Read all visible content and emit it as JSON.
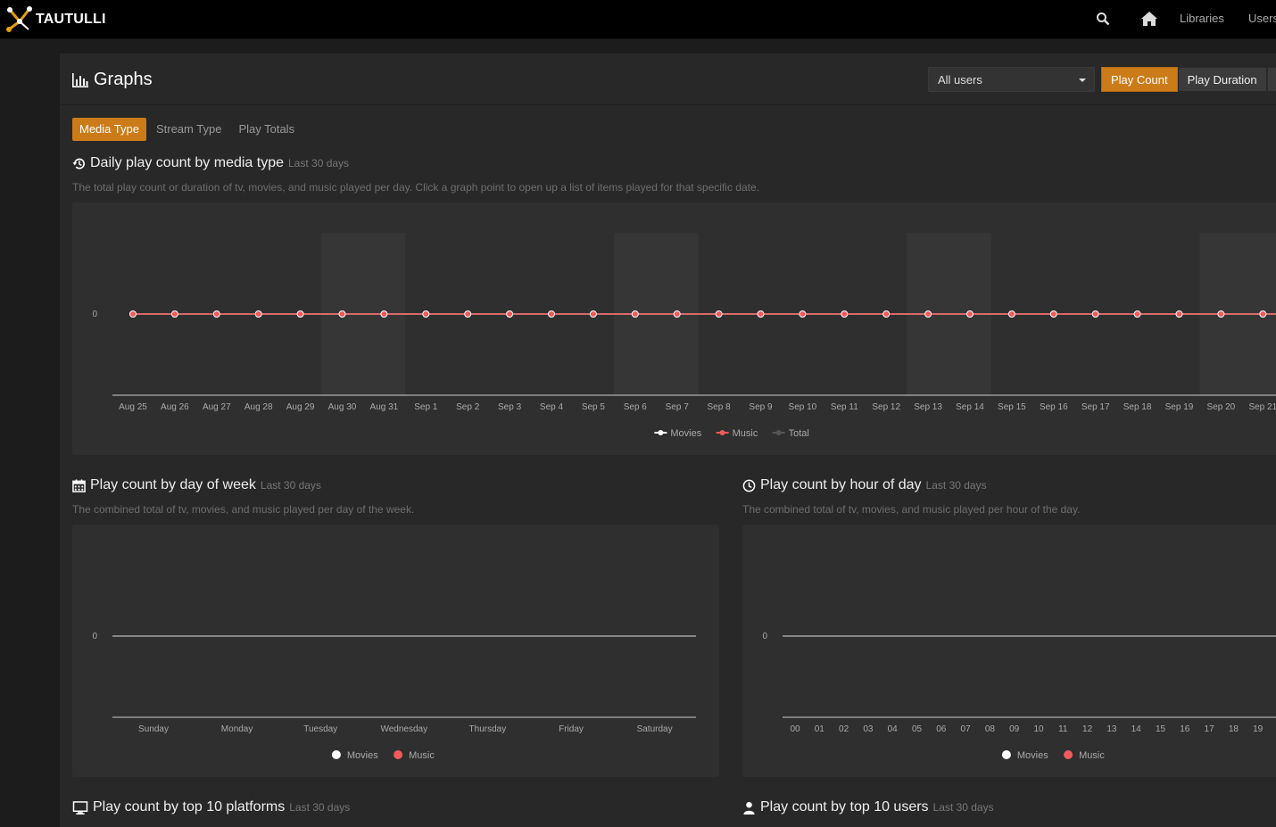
{
  "app": {
    "brand": "TAUTULLI"
  },
  "nav": {
    "links": [
      "Libraries",
      "Users"
    ]
  },
  "page": {
    "title": "Graphs",
    "user_filter": "All users",
    "metric_buttons": [
      "Play Count",
      "Play Duration"
    ],
    "active_metric": "Play Count",
    "tabs": [
      "Media Type",
      "Stream Type",
      "Play Totals"
    ],
    "active_tab": "Media Type"
  },
  "sections": {
    "daily": {
      "title": "Daily play count by media type",
      "range": "Last 30 days",
      "description": "The total play count or duration of tv, movies, and music played per day. Click a graph point to open up a list of items played for that specific date."
    },
    "dow": {
      "title": "Play count by day of week",
      "range": "Last 30 days",
      "description": "The combined total of tv, movies, and music played per day of the week."
    },
    "hour": {
      "title": "Play count by hour of day",
      "range": "Last 30 days",
      "description": "The combined total of tv, movies, and music played per hour of the day."
    },
    "platforms": {
      "title": "Play count by top 10 platforms",
      "range": "Last 30 days"
    },
    "users": {
      "title": "Play count by top 10 users",
      "range": "Last 30 days"
    }
  },
  "colors": {
    "accent": "#cc7b19",
    "music": "#f05a5a",
    "movies": "#ffffff",
    "total": "#555555"
  },
  "chart_data": [
    {
      "id": "daily",
      "type": "line",
      "x": [
        "Aug 25",
        "Aug 26",
        "Aug 27",
        "Aug 28",
        "Aug 29",
        "Aug 30",
        "Aug 31",
        "Sep 1",
        "Sep 2",
        "Sep 3",
        "Sep 4",
        "Sep 5",
        "Sep 6",
        "Sep 7",
        "Sep 8",
        "Sep 9",
        "Sep 10",
        "Sep 11",
        "Sep 12",
        "Sep 13",
        "Sep 14",
        "Sep 15",
        "Sep 16",
        "Sep 17",
        "Sep 18",
        "Sep 19",
        "Sep 20",
        "Sep 21"
      ],
      "y_ticks": [
        "0"
      ],
      "weekend_bands": [
        [
          "Aug 30",
          "Aug 31"
        ],
        [
          "Sep 6",
          "Sep 7"
        ],
        [
          "Sep 13",
          "Sep 14"
        ],
        [
          "Sep 20",
          "Sep 21"
        ]
      ],
      "series": [
        {
          "name": "Movies",
          "values": [
            0,
            0,
            0,
            0,
            0,
            0,
            0,
            0,
            0,
            0,
            0,
            0,
            0,
            0,
            0,
            0,
            0,
            0,
            0,
            0,
            0,
            0,
            0,
            0,
            0,
            0,
            0,
            0
          ]
        },
        {
          "name": "Music",
          "values": [
            0,
            0,
            0,
            0,
            0,
            0,
            0,
            0,
            0,
            0,
            0,
            0,
            0,
            0,
            0,
            0,
            0,
            0,
            0,
            0,
            0,
            0,
            0,
            0,
            0,
            0,
            0,
            0
          ]
        },
        {
          "name": "Total",
          "values": []
        }
      ],
      "legend": "bottom-center"
    },
    {
      "id": "dow",
      "type": "bar",
      "categories": [
        "Sunday",
        "Monday",
        "Tuesday",
        "Wednesday",
        "Thursday",
        "Friday",
        "Saturday"
      ],
      "y_ticks": [
        "0"
      ],
      "series": [
        {
          "name": "Movies",
          "values": [
            0,
            0,
            0,
            0,
            0,
            0,
            0
          ]
        },
        {
          "name": "Music",
          "values": [
            0,
            0,
            0,
            0,
            0,
            0,
            0
          ]
        }
      ],
      "legend": "bottom-center"
    },
    {
      "id": "hour",
      "type": "bar",
      "categories": [
        "00",
        "01",
        "02",
        "03",
        "04",
        "05",
        "06",
        "07",
        "08",
        "09",
        "10",
        "11",
        "12",
        "13",
        "14",
        "15",
        "16",
        "17",
        "18",
        "19"
      ],
      "y_ticks": [
        "0"
      ],
      "series": [
        {
          "name": "Movies",
          "values": [
            0,
            0,
            0,
            0,
            0,
            0,
            0,
            0,
            0,
            0,
            0,
            0,
            0,
            0,
            0,
            0,
            0,
            0,
            0,
            0
          ]
        },
        {
          "name": "Music",
          "values": [
            0,
            0,
            0,
            0,
            0,
            0,
            0,
            0,
            0,
            0,
            0,
            0,
            0,
            0,
            0,
            0,
            0,
            0,
            0,
            0
          ]
        }
      ],
      "legend": "bottom-center"
    }
  ]
}
